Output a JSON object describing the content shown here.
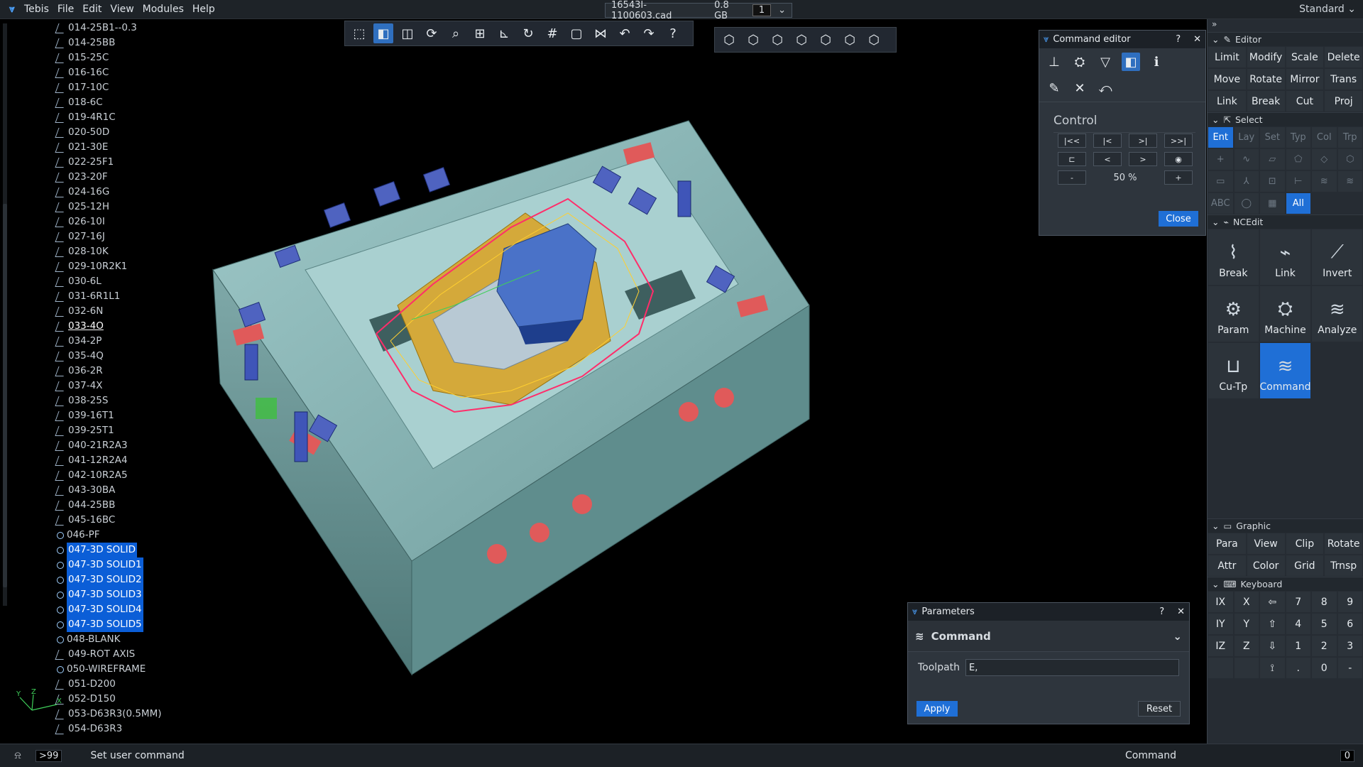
{
  "menubar": {
    "items": [
      "Tebis",
      "File",
      "Edit",
      "View",
      "Modules",
      "Help"
    ],
    "file_name": "16543I-1100603.cad",
    "file_size": "0.8 GB",
    "page": "1",
    "workspace": "Standard"
  },
  "tree": {
    "items": [
      {
        "label": "014-25B1--0.3",
        "kind": "path"
      },
      {
        "label": "014-25BB",
        "kind": "path"
      },
      {
        "label": "015-25C",
        "kind": "path"
      },
      {
        "label": "016-16C",
        "kind": "path"
      },
      {
        "label": "017-10C",
        "kind": "path"
      },
      {
        "label": "018-6C",
        "kind": "path"
      },
      {
        "label": "019-4R1C",
        "kind": "path"
      },
      {
        "label": "020-50D",
        "kind": "path"
      },
      {
        "label": "021-30E",
        "kind": "path"
      },
      {
        "label": "022-25F1",
        "kind": "path"
      },
      {
        "label": "023-20F",
        "kind": "path"
      },
      {
        "label": "024-16G",
        "kind": "path"
      },
      {
        "label": "025-12H",
        "kind": "path"
      },
      {
        "label": "026-10I",
        "kind": "path"
      },
      {
        "label": "027-16J",
        "kind": "path"
      },
      {
        "label": "028-10K",
        "kind": "path"
      },
      {
        "label": "029-10R2K1",
        "kind": "path"
      },
      {
        "label": "030-6L",
        "kind": "path"
      },
      {
        "label": "031-6R1L1",
        "kind": "path"
      },
      {
        "label": "032-6N",
        "kind": "path"
      },
      {
        "label": "033-4O",
        "kind": "path",
        "current": true
      },
      {
        "label": "034-2P",
        "kind": "path"
      },
      {
        "label": "035-4Q",
        "kind": "path"
      },
      {
        "label": "036-2R",
        "kind": "path"
      },
      {
        "label": "037-4X",
        "kind": "path"
      },
      {
        "label": "038-25S",
        "kind": "path"
      },
      {
        "label": "039-16T1",
        "kind": "path"
      },
      {
        "label": "039-25T1",
        "kind": "path"
      },
      {
        "label": "040-21R2A3",
        "kind": "path"
      },
      {
        "label": "041-12R2A4",
        "kind": "path"
      },
      {
        "label": "042-10R2A5",
        "kind": "path"
      },
      {
        "label": "043-30BA",
        "kind": "path"
      },
      {
        "label": "044-25BB",
        "kind": "path"
      },
      {
        "label": "045-16BC",
        "kind": "path"
      },
      {
        "label": "046-PF",
        "kind": "solid"
      },
      {
        "label": "047-3D SOLID",
        "kind": "solid",
        "selected": true
      },
      {
        "label": "047-3D SOLID1",
        "kind": "solid",
        "selected": true
      },
      {
        "label": "047-3D SOLID2",
        "kind": "solid",
        "selected": true
      },
      {
        "label": "047-3D SOLID3",
        "kind": "solid",
        "selected": true
      },
      {
        "label": "047-3D SOLID4",
        "kind": "solid",
        "selected": true
      },
      {
        "label": "047-3D SOLID5",
        "kind": "solid",
        "selected": true
      },
      {
        "label": "048-BLANK",
        "kind": "solid"
      },
      {
        "label": "049-ROT AXIS",
        "kind": "path"
      },
      {
        "label": "050-WIREFRAME",
        "kind": "solid"
      },
      {
        "label": "051-D200",
        "kind": "path"
      },
      {
        "label": "052-D150",
        "kind": "path"
      },
      {
        "label": "053-D63R3(0.5MM)",
        "kind": "path"
      },
      {
        "label": "054-D63R3",
        "kind": "path"
      }
    ]
  },
  "triad": {
    "y": "Y",
    "z": "Z",
    "x": "X"
  },
  "toolbar_view": {
    "icons": [
      "wireframe-cube-icon",
      "shaded-cube-icon",
      "hidden-cube-icon",
      "rotate-icon",
      "zoom-icon",
      "fit-icon",
      "axis-icon",
      "refresh-icon",
      "grid-icon",
      "frame-icon",
      "section-icon",
      "back-arrow-icon",
      "forward-arrow-icon",
      "help-cursor-icon"
    ],
    "glyphs": [
      "⬚",
      "◧",
      "◫",
      "⟳",
      "⌕",
      "⊞",
      "⊾",
      "↻",
      "#",
      "▢",
      "⋈",
      "↶",
      "↷",
      "?"
    ],
    "active_index": 1
  },
  "toolbar_orient": {
    "icons": [
      "iso-view-1-icon",
      "iso-view-2-icon",
      "iso-view-3-icon",
      "iso-view-4-icon",
      "iso-view-5-icon",
      "iso-view-6-icon",
      "iso-view-7-icon"
    ],
    "glyphs": [
      "⬡",
      "⬡",
      "⬡",
      "⬡",
      "⬡",
      "⬡",
      "⬡"
    ]
  },
  "command_editor": {
    "title": "Command editor",
    "help": "?",
    "close_x": "✕",
    "row1": [
      "⊥",
      "⛭",
      "▽",
      "◧",
      "ℹ"
    ],
    "row2": [
      "✎",
      "✕",
      "⤺"
    ],
    "control_title": "Control",
    "ctrl_rows": [
      [
        "|<<",
        "|<",
        ">|",
        ">>|"
      ],
      [
        "⊏",
        "<",
        ">",
        "◉"
      ]
    ],
    "minus": "-",
    "zoom": "50 %",
    "plus": "+",
    "close_label": "Close"
  },
  "parameters": {
    "title": "Parameters",
    "help": "?",
    "close_x": "✕",
    "section": "Command",
    "field_label": "Toolpath",
    "field_value": "E,",
    "apply": "Apply",
    "reset": "Reset"
  },
  "rpanel": {
    "top": "»",
    "editor_title": "Editor",
    "editor_buttons": [
      "Limit",
      "Modify",
      "Scale",
      "Delete",
      "Move",
      "Rotate",
      "Mirror",
      "Trans",
      "Link",
      "Break",
      "Cut",
      "Proj"
    ],
    "select_title": "Select",
    "select_row1": [
      "Ent",
      "Lay",
      "Set",
      "Typ",
      "Col",
      "Trp"
    ],
    "select_row2": [
      "+",
      "∿",
      "▱",
      "⬠",
      "◇",
      "⬡"
    ],
    "select_row3": [
      "▭",
      "⅄",
      "⊡",
      "⊢",
      "≋",
      "≋"
    ],
    "select_row4": [
      "ABC",
      "◯",
      "▦",
      "All"
    ],
    "ncedit_title": "NCEdit",
    "ncedit_buttons": [
      {
        "label": "Break",
        "icon": "break-toolpath-icon",
        "glyph": "⌇"
      },
      {
        "label": "Link",
        "icon": "link-toolpath-icon",
        "glyph": "⌁"
      },
      {
        "label": "Invert",
        "icon": "invert-icon",
        "glyph": "⟋"
      },
      {
        "label": "Param",
        "icon": "param-icon",
        "glyph": "⚙"
      },
      {
        "label": "Machine",
        "icon": "machine-icon",
        "glyph": "⛭"
      },
      {
        "label": "Analyze",
        "icon": "analyze-icon",
        "glyph": "≋"
      },
      {
        "label": "Cu-Tp",
        "icon": "cu-tp-icon",
        "glyph": "⊔"
      },
      {
        "label": "Command",
        "icon": "command-icon",
        "glyph": "≋"
      }
    ],
    "graphic_title": "Graphic",
    "graphic_buttons": [
      "Para",
      "View",
      "Clip",
      "Rotate",
      "Attr",
      "Color",
      "Grid",
      "Trnsp"
    ],
    "keyboard_title": "Keyboard",
    "keyboard_keys": [
      "IX",
      "X",
      "⇦",
      "7",
      "8",
      "9",
      "IY",
      "Y",
      "⇧",
      "4",
      "5",
      "6",
      "IZ",
      "Z",
      "⇩",
      "1",
      "2",
      "3",
      "",
      "",
      "⟟",
      ".",
      "0",
      "-"
    ]
  },
  "statusbar": {
    "bell": "🔔",
    "count": ">99",
    "message": "Set user command",
    "mode": "Command",
    "right_num": "0"
  }
}
